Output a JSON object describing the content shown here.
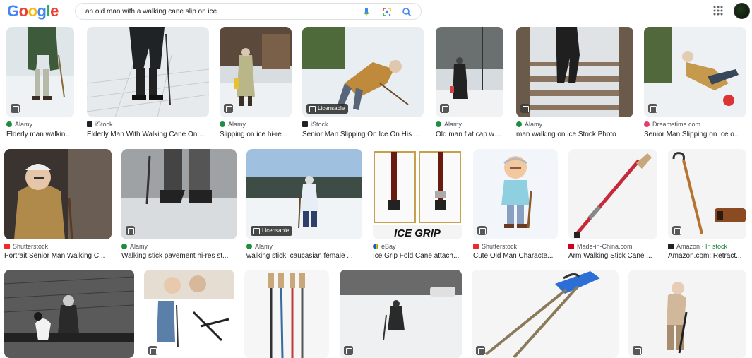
{
  "search": {
    "query": "an old man with a walking cane slip on ice"
  },
  "logo": {
    "g1": "G",
    "o1": "o",
    "o2": "o",
    "g2": "g",
    "l": "l",
    "e": "e"
  },
  "results": [
    {
      "source": "Alamy",
      "title": "Elderly man walking...",
      "fav_color": "#1e8e3e"
    },
    {
      "source": "iStock",
      "title": "Elderly Man With Walking Cane On ...",
      "fav_color": "#202124"
    },
    {
      "source": "Alamy",
      "title": "Slipping on ice hi-re...",
      "fav_color": "#1e8e3e"
    },
    {
      "source": "iStock",
      "title": "Senior Man Slipping On Ice On His ...",
      "fav_color": "#202124",
      "badge": "Licensable"
    },
    {
      "source": "Alamy",
      "title": "Old man flat cap wa...",
      "fav_color": "#1e8e3e"
    },
    {
      "source": "Alamy",
      "title": "man walking on ice Stock Photo ...",
      "fav_color": "#1e8e3e"
    },
    {
      "source": "Dreamstime.com",
      "title": "Senior Man Slipping on Ice o...",
      "fav_color": "#e8396a"
    },
    {
      "source": "Shutterstock",
      "title": "Portrait Senior Man Walking C...",
      "fav_color": "#ee2b2b"
    },
    {
      "source": "Alamy",
      "title": "Walking stick pavement hi-res st...",
      "fav_color": "#1e8e3e"
    },
    {
      "source": "Alamy",
      "title": "walking stick. caucasian female ...",
      "fav_color": "#1e8e3e",
      "badge": "Licensable"
    },
    {
      "source": "eBay",
      "title": "Ice Grip Fold Cane attach...",
      "fav_color": "#e53238",
      "image_text": "ICE GRIP"
    },
    {
      "source": "Shutterstock",
      "title": "Cute Old Man Characte...",
      "fav_color": "#ee2b2b"
    },
    {
      "source": "Made-in-China.com",
      "title": "Arm Walking Stick Cane ...",
      "fav_color": "#d0021b"
    },
    {
      "source": "Amazon",
      "stock": " · In stock",
      "title": "Amazon.com: Retract...",
      "fav_color": "#222222"
    }
  ]
}
